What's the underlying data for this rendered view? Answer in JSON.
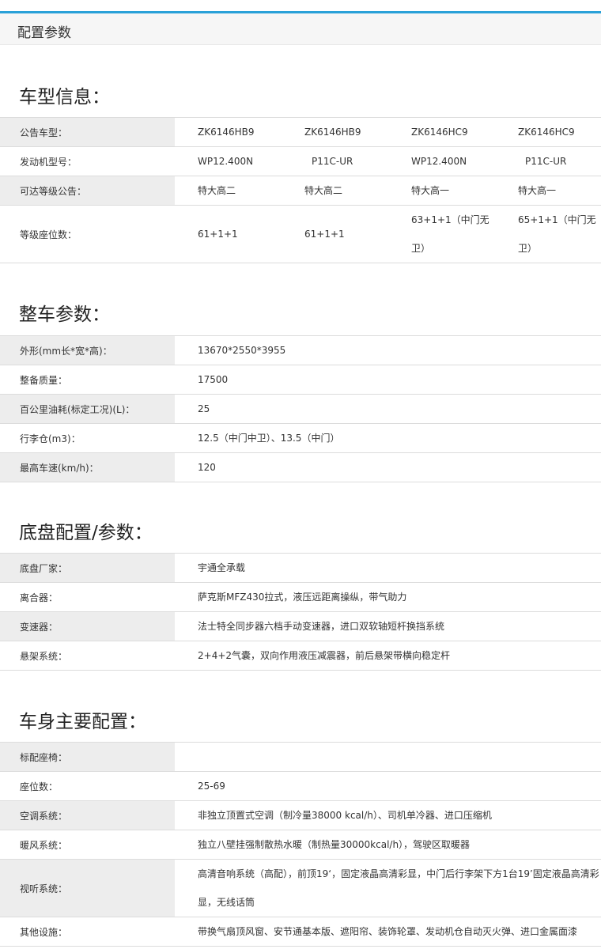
{
  "page": {
    "title": "配置参数"
  },
  "sections": {
    "vehicle": {
      "heading": "车型信息：",
      "rows": [
        {
          "label": "公告车型：",
          "values": [
            "ZK6146HB9",
            "ZK6146HB9",
            "ZK6146HC9",
            "ZK6146HC9"
          ]
        },
        {
          "label": "发动机型号：",
          "values": [
            "WP12.400N",
            "P11C-UR",
            "WP12.400N",
            "P11C-UR"
          ]
        },
        {
          "label": "可达等级公告：",
          "values": [
            "特大高二",
            "特大高二",
            "特大高一",
            "特大高一"
          ]
        },
        {
          "label": "等级座位数：",
          "values": [
            "61+1+1",
            "61+1+1",
            "63+1+1（中门无卫）",
            "65+1+1（中门无卫）"
          ]
        }
      ]
    },
    "whole": {
      "heading": "整车参数：",
      "rows": [
        {
          "label": "外形(mm长*宽*高)：",
          "value": "13670*2550*3955"
        },
        {
          "label": "整备质量：",
          "value": "17500"
        },
        {
          "label": "百公里油耗(标定工况)(L)：",
          "value": "25"
        },
        {
          "label": "行李仓(m3)：",
          "value": "12.5（中门中卫）、13.5（中门）"
        },
        {
          "label": "最高车速(km/h)：",
          "value": "120"
        }
      ]
    },
    "chassis": {
      "heading": "底盘配置/参数：",
      "rows": [
        {
          "label": "底盘厂家：",
          "value": "宇通全承载"
        },
        {
          "label": "离合器：",
          "value": "萨克斯MFZ430拉式，液压远距离操纵，带气助力"
        },
        {
          "label": "变速器：",
          "value": "法士特全同步器六档手动变速器，进口双软轴短杆换挡系统"
        },
        {
          "label": "悬架系统：",
          "value": "2+4+2气囊，双向作用液压减震器，前后悬架带横向稳定杆"
        }
      ]
    },
    "body": {
      "heading": "车身主要配置：",
      "rows": [
        {
          "label": "标配座椅：",
          "value": ""
        },
        {
          "label": "座位数：",
          "value": "25-69"
        },
        {
          "label": "空调系统：",
          "value": "非独立顶置式空调（制冷量38000 kcal/h）、司机单冷器、进口压缩机"
        },
        {
          "label": "暖风系统：",
          "value": "独立八壁挂强制散热水暖（制热量30000kcal/h），驾驶区取暖器"
        },
        {
          "label": "视听系统：",
          "value": "高清音响系统（高配），前顶19‘，固定液晶高清彩显，中门后行李架下方1台19’固定液晶高清彩显，无线话筒"
        },
        {
          "label": "其他设施：",
          "value": "带换气扇顶风窗、安节通基本版、遮阳帘、装饰轮罩、发动机仓自动灭火弹、进口金属面漆"
        }
      ]
    }
  }
}
